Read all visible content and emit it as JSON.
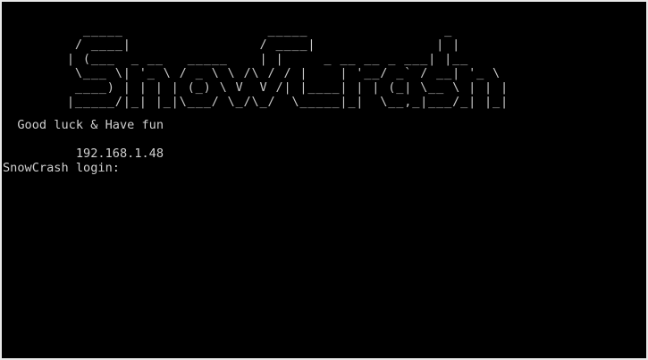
{
  "console": {
    "banner_lines": [
      "          _____                  _____                 _     ",
      "         / ____|                / ____|               | |    ",
      "        | (___  _ __   _____    | |     _ __ __ _ ___| |__  ",
      "         \\___ \\| '_ \\ / _ \\ \\ /\\ / / |    | '__/ _` / __| '_ \\ ",
      "         ____) | | | | (_) \\ V  V /| |____| | | (_| \\__ \\ | | |",
      "        |_____/|_| |_|\\___/ \\_/\\_/  \\_____|_|  \\__,_|___/_| |_|"
    ],
    "greeting": "  Good luck & Have fun",
    "ip_address": "192.168.1.48",
    "login_prompt": "SnowCrash login:",
    "login_value": ""
  },
  "colors": {
    "background": "#000000",
    "text": "#d0d0d0",
    "frame": "#e8e8e8"
  }
}
